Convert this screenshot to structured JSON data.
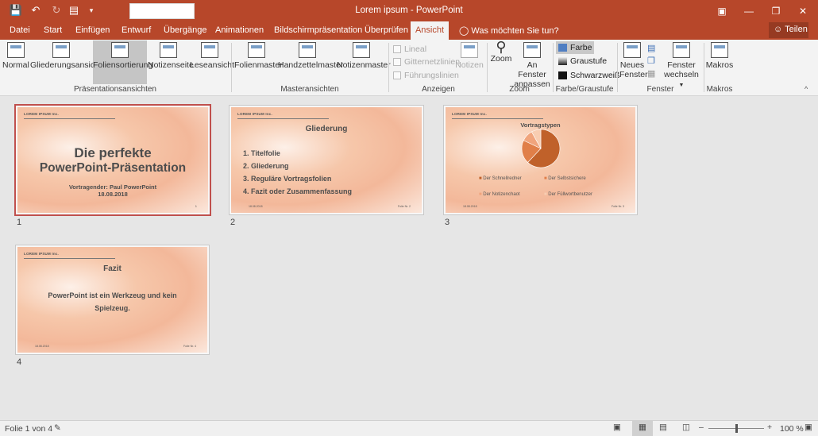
{
  "app": {
    "title": "Lorem ipsum  -  PowerPoint"
  },
  "tabs": [
    "Datei",
    "Start",
    "Einfügen",
    "Entwurf",
    "Übergänge",
    "Animationen",
    "Bildschirmpräsentation",
    "Überprüfen",
    "Ansicht"
  ],
  "tell_me": "Was möchten Sie tun?",
  "share_label": "Teilen",
  "ribbon": {
    "pres_views": {
      "buttons": [
        "Normal",
        "Gliederungsansicht",
        "Foliensortierung",
        "Notizenseite",
        "Leseansicht"
      ],
      "label": "Präsentationsansichten"
    },
    "master_views": {
      "buttons": [
        "Folienmaster",
        "Handzettelmaster",
        "Notizenmaster"
      ],
      "label": "Masteransichten"
    },
    "show": {
      "checks": [
        "Lineal",
        "Gitternetzlinien",
        "Führungslinien"
      ],
      "notes": "Notizen",
      "label": "Anzeigen"
    },
    "zoom": {
      "zoom": "Zoom",
      "fit1": "An Fenster",
      "fit2": "anpassen",
      "label": "Zoom"
    },
    "color": {
      "options": [
        "Farbe",
        "Graustufe",
        "Schwarzweiß"
      ],
      "label": "Farbe/Graustufe",
      "swatches": [
        "#4f7ec2",
        "#8c8c8c",
        "#111111"
      ]
    },
    "window": {
      "new1": "Neues",
      "new2": "Fenster",
      "switch1": "Fenster",
      "switch2": "wechseln",
      "label": "Fenster"
    },
    "macros": {
      "button": "Makros",
      "label": "Makros"
    }
  },
  "slides": [
    {
      "number": "1",
      "company": "LOREM IPSUM Inc.",
      "title_line1": "Die perfekte",
      "title_line2": "PowerPoint-Präsentation",
      "subtitle_line1": "Vortragender: Paul PowerPoint",
      "subtitle_line2": "18.08.2018",
      "page": "1"
    },
    {
      "number": "2",
      "company": "LOREM IPSUM Inc.",
      "title": "Gliederung",
      "items": [
        "1. Titelfolie",
        "2. Gliederung",
        "3. Reguläre Vortragsfolien",
        "4. Fazit oder Zusammenfassung"
      ],
      "date": "18.08.2018",
      "page": "Folie Nr. 2"
    },
    {
      "number": "3",
      "company": "LOREM IPSUM Inc.",
      "title": "Vortragstypen",
      "legend": [
        "Der Schnellredner",
        "Der Selbstsichere",
        "Der Notizenchaot",
        "Der Füllwortbenutzer"
      ],
      "date": "18.08.2018",
      "page": "Folie Nr. 3"
    },
    {
      "number": "4",
      "company": "LOREM IPSUM Inc.",
      "title": "Fazit",
      "body_line1": "PowerPoint ist ein Werkzeug und kein",
      "body_line2": "Spielzeug.",
      "date": "18.08.2018",
      "page": "Folie Nr. 4"
    }
  ],
  "chart_data": {
    "type": "pie",
    "title": "Vortragstypen",
    "categories": [
      "Der Schnellredner",
      "Der Selbstsichere",
      "Der Notizenchaot",
      "Der Füllwortbenutzer"
    ],
    "values": [
      62,
      20,
      10,
      8
    ],
    "colors": [
      "#c0612a",
      "#e07f49",
      "#f0a47c",
      "#f8cdb1"
    ]
  },
  "status": {
    "slide_info": "Folie 1 von 4",
    "zoom": "100 %"
  }
}
